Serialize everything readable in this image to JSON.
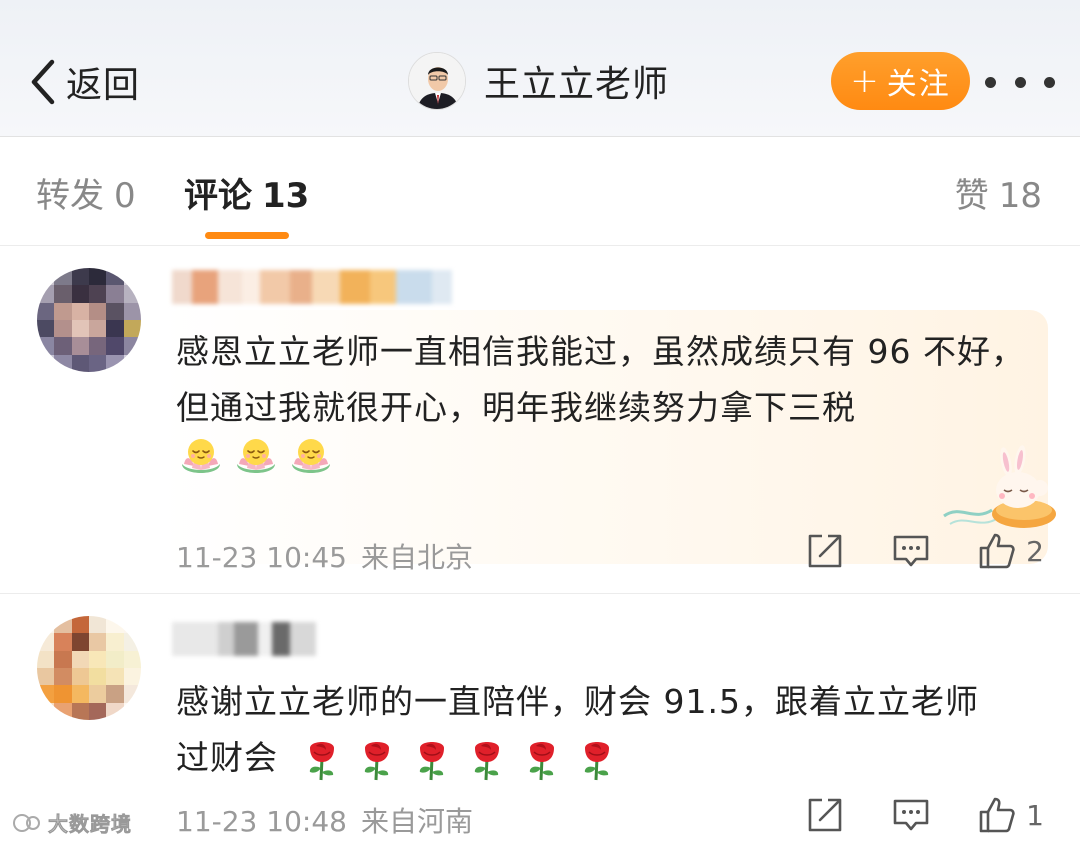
{
  "header": {
    "back_label": "返回",
    "user_name": "王立立老师",
    "follow_label": "关注",
    "follow_plus": "+"
  },
  "tabs": {
    "repost_label": "转发",
    "repost_count": "0",
    "comments_label": "评论",
    "comments_count": "13",
    "likes_label": "赞",
    "likes_count": "18"
  },
  "comments": [
    {
      "text": "感恩立立老师一直相信我能过，虽然成绩只有 96 不好，但通过我就很开心，明年我继续努力拿下三税",
      "emoji": "lotus-smile-icon",
      "emoji_count": 3,
      "time": "11-23 10:45",
      "location": "来自北京",
      "like_count": "2"
    },
    {
      "text_line1": "感谢立立老师的一直陪伴，财会 91.5，跟着立立老师",
      "text_line2": "过财会",
      "emoji": "rose-icon",
      "emoji_count": 6,
      "time": "11-23 10:48",
      "location": "来自河南",
      "like_count": "1"
    }
  ],
  "watermark": "大数跨境",
  "colors": {
    "accent": "#ff8a12",
    "text_primary": "#222222",
    "text_secondary": "#9a9a9a"
  }
}
